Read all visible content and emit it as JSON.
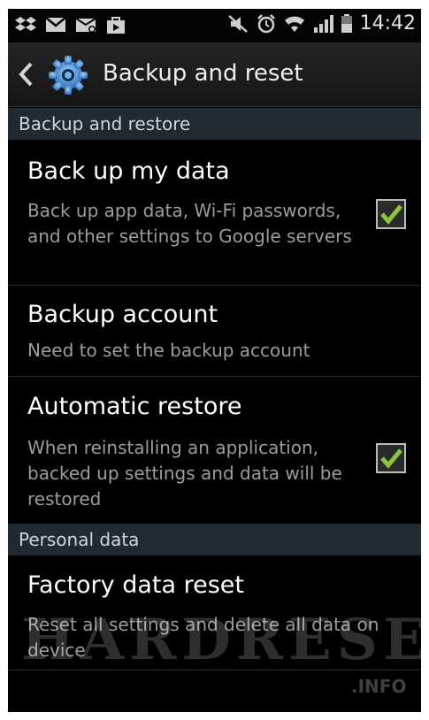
{
  "status_bar": {
    "time": "14:42",
    "left_icons": [
      "dropbox-icon",
      "gmail-icon",
      "voicemail-icon",
      "shopping-icon"
    ],
    "right_icons": [
      "mute-icon",
      "alarm-icon",
      "wifi-icon",
      "signal-icon",
      "battery-icon"
    ]
  },
  "action_bar": {
    "title": "Backup and reset",
    "back_icon": "chevron-left-icon",
    "app_icon": "settings-gear-icon"
  },
  "sections": [
    {
      "header": "Backup and restore",
      "items": [
        {
          "title": "Back up my data",
          "summary": "Back up app data, Wi-Fi passwords, and other settings to Google servers",
          "checked": true
        },
        {
          "title": "Backup account",
          "summary": "Need to set the backup account"
        },
        {
          "title": "Automatic restore",
          "summary": "When reinstalling an application, backed up settings and data will be restored",
          "checked": true
        }
      ]
    },
    {
      "header": "Personal data",
      "items": [
        {
          "title": "Factory data reset",
          "summary": "Reset all settings and delete all data on device"
        }
      ]
    }
  ],
  "watermark": {
    "text": "HARDRESET",
    "suffix": ".INFO"
  },
  "colors": {
    "background": "#000000",
    "section_bg": "#1f2a33",
    "check_green": "#8bc53f",
    "secondary_text": "#9c9c9c"
  }
}
